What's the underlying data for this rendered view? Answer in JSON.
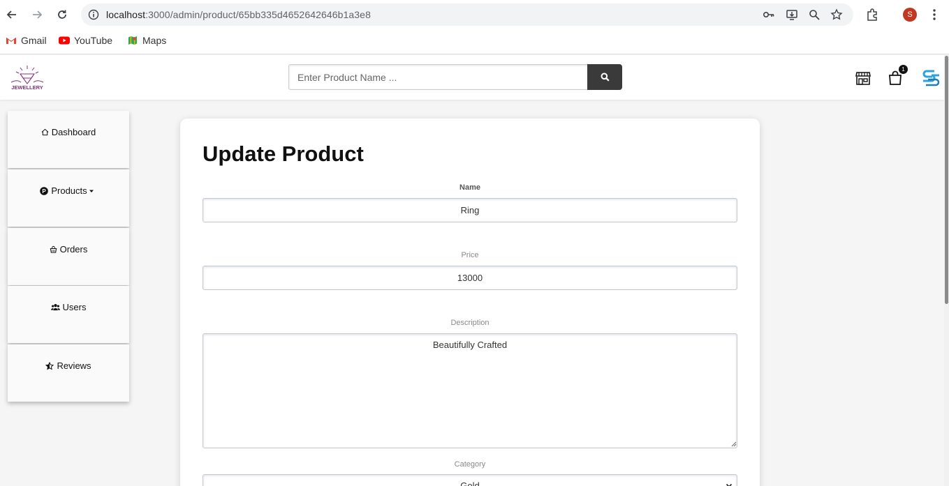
{
  "browser": {
    "url_host": "localhost",
    "url_path": ":3000/admin/product/65bb335d4652642646b1a3e8",
    "profile_initial": "S",
    "bookmarks": [
      {
        "label": "Gmail"
      },
      {
        "label": "YouTube"
      },
      {
        "label": "Maps"
      }
    ]
  },
  "header": {
    "search_placeholder": "Enter Product Name ...",
    "cart_count": "1"
  },
  "sidebar": {
    "items": [
      {
        "label": "Dashboard"
      },
      {
        "label": "Products"
      },
      {
        "label": "Orders"
      },
      {
        "label": "Users"
      },
      {
        "label": "Reviews"
      }
    ]
  },
  "form": {
    "title": "Update Product",
    "name_label": "Name",
    "name_value": "Ring",
    "price_label": "Price",
    "price_value": "13000",
    "description_label": "Description",
    "description_value": "Beautifully Crafted",
    "category_label": "Category",
    "category_value": "Gold"
  }
}
